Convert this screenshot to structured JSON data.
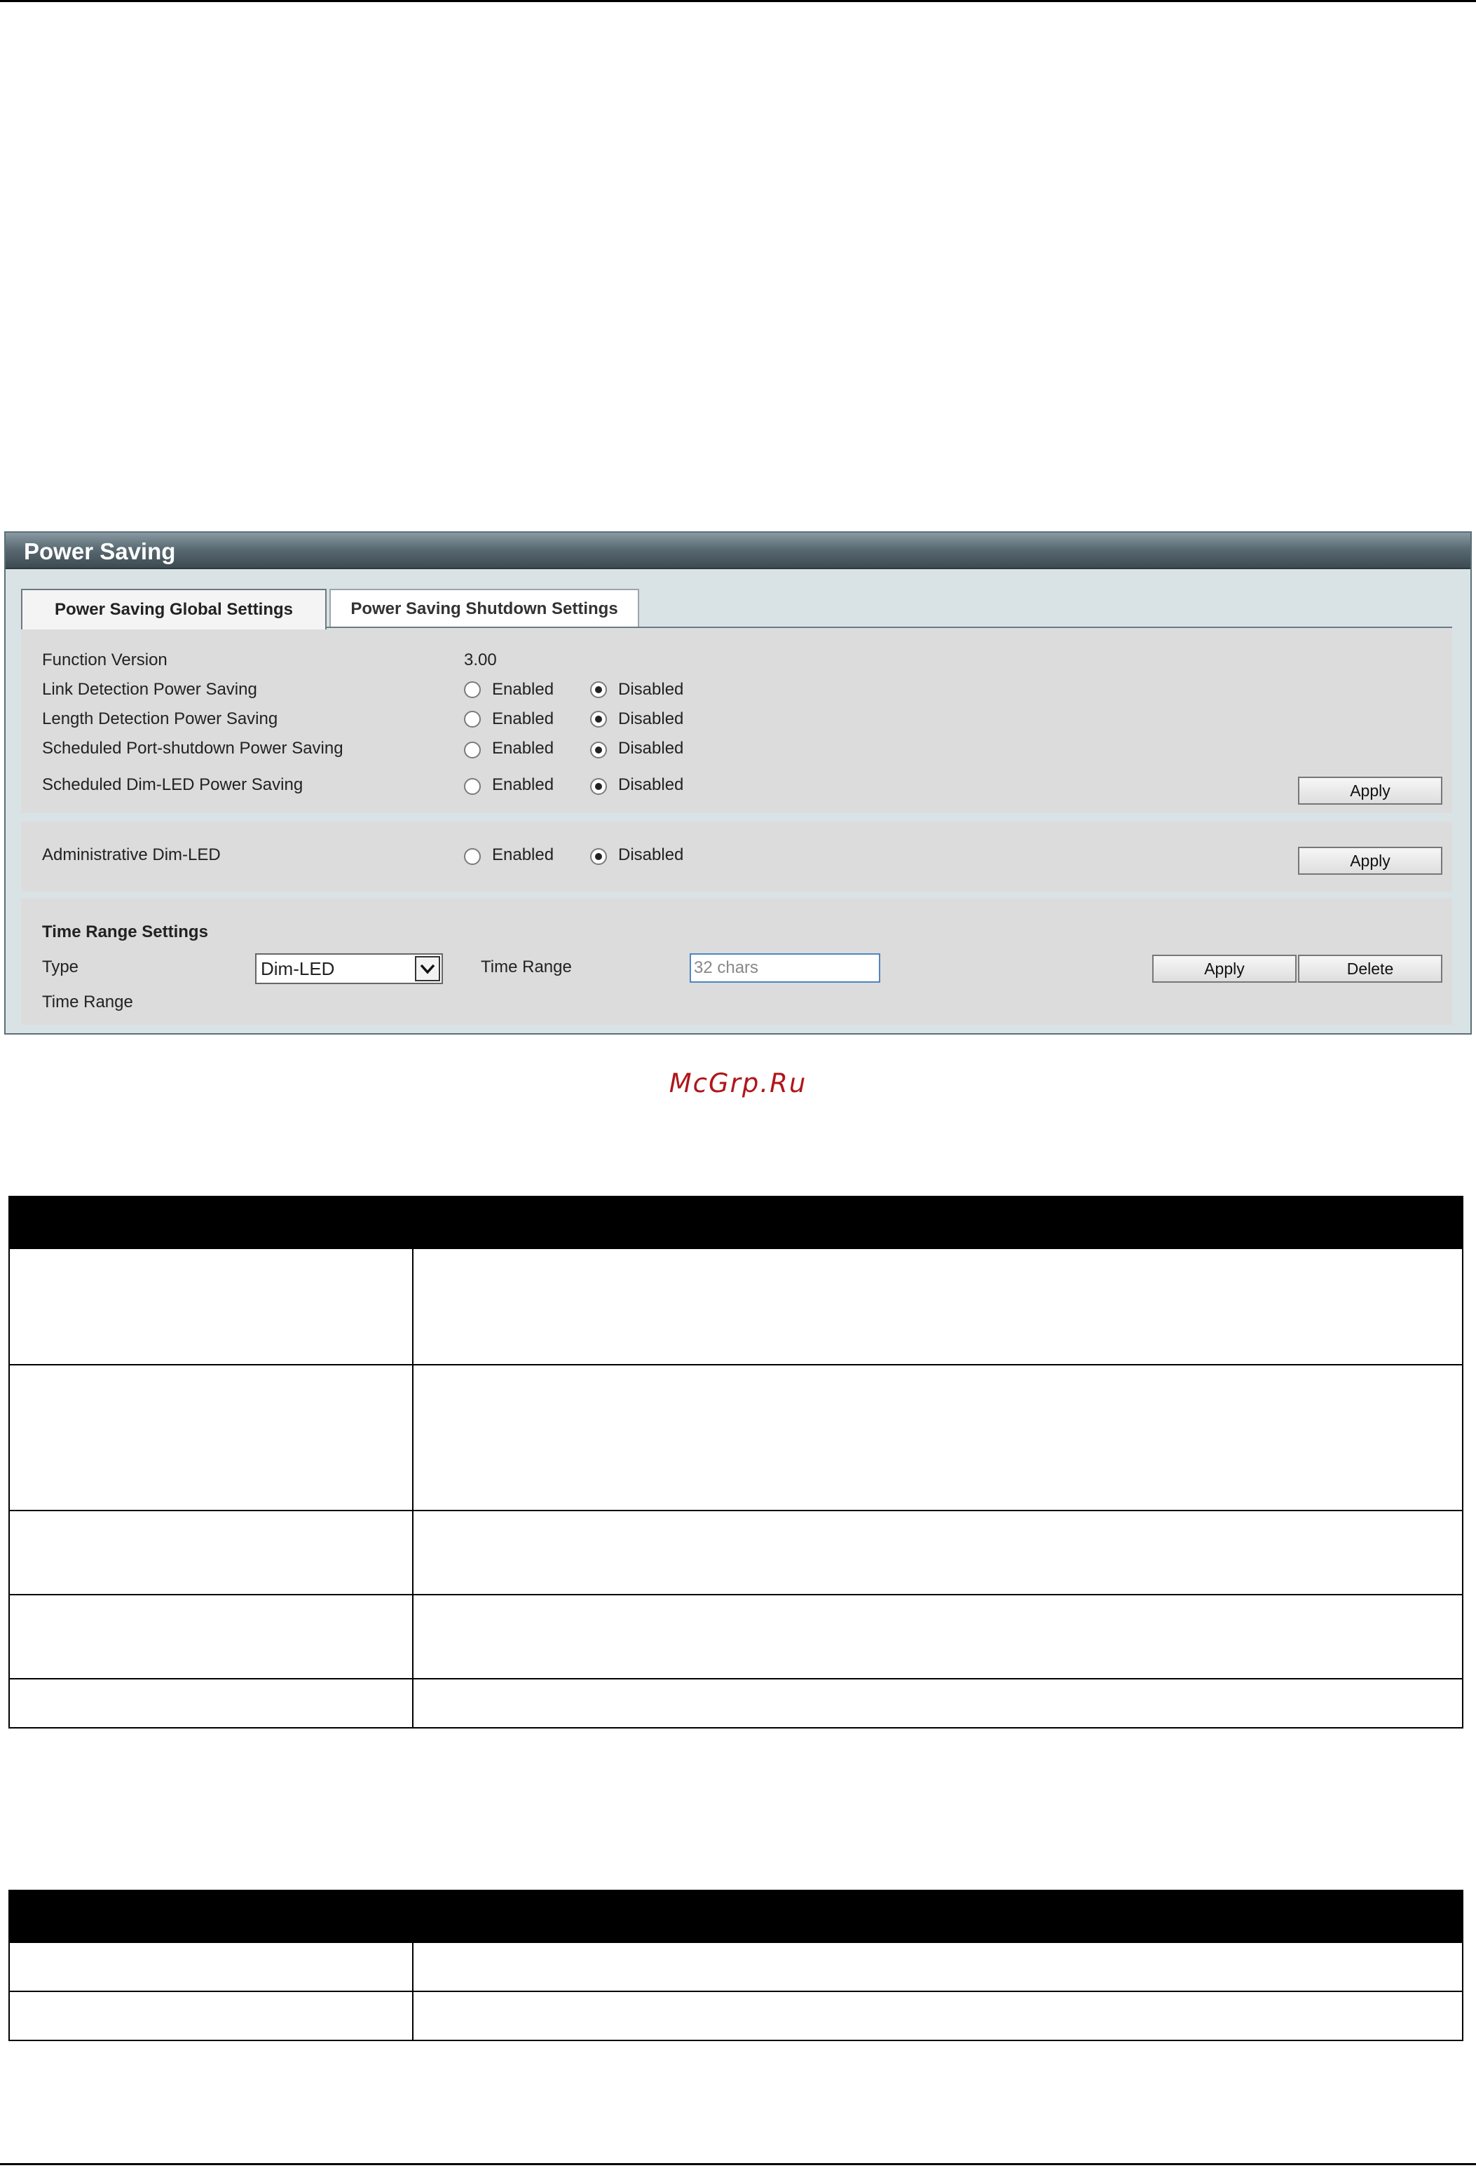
{
  "panel": {
    "title": "Power Saving",
    "tabs": [
      {
        "label": "Power Saving Global Settings",
        "active": true
      },
      {
        "label": "Power Saving Shutdown Settings",
        "active": false
      }
    ],
    "global": {
      "function_version_label": "Function Version",
      "function_version_value": "3.00",
      "rows": [
        {
          "label": "Link Detection Power Saving",
          "enabled": "Enabled",
          "disabled": "Disabled",
          "selected": "Disabled"
        },
        {
          "label": "Length Detection Power Saving",
          "enabled": "Enabled",
          "disabled": "Disabled",
          "selected": "Disabled"
        },
        {
          "label": "Scheduled Port-shutdown Power Saving",
          "enabled": "Enabled",
          "disabled": "Disabled",
          "selected": "Disabled"
        },
        {
          "label": "Scheduled Dim-LED Power Saving",
          "enabled": "Enabled",
          "disabled": "Disabled",
          "selected": "Disabled"
        }
      ],
      "apply_label": "Apply"
    },
    "dim_led": {
      "label": "Administrative Dim-LED",
      "enabled": "Enabled",
      "disabled": "Disabled",
      "selected": "Disabled",
      "apply_label": "Apply"
    },
    "time_range": {
      "heading": "Time Range Settings",
      "type_label": "Type",
      "type_value": "Dim-LED",
      "time_range_label": "Time Range",
      "time_range_placeholder": "32 chars",
      "apply_label": "Apply",
      "delete_label": "Delete",
      "time_range_list_label": "Time Range"
    }
  },
  "watermark": "McGrp.Ru",
  "colors": {
    "panel_bg": "#d9e3e6",
    "section_bg": "#dcdcdc",
    "titlebar": "#4b5a62",
    "watermark": "#b0161b"
  }
}
